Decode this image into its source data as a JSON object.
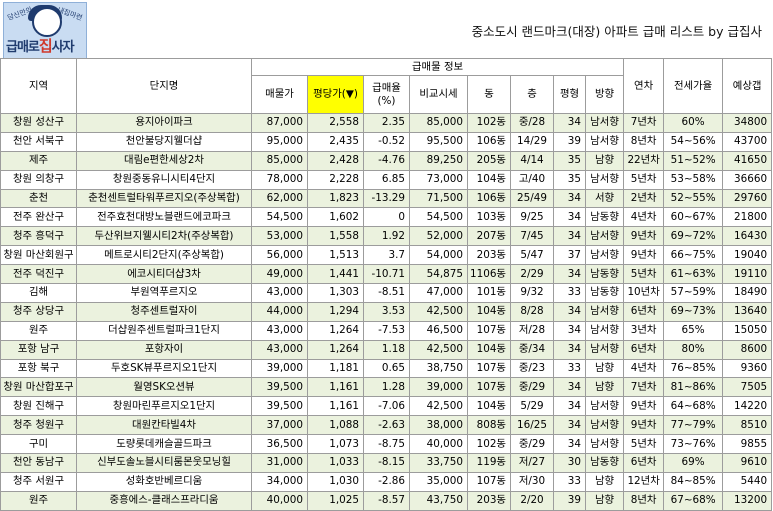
{
  "logo": {
    "top_left": "당신만의",
    "top_right": "내집마련",
    "name_a": "급매로",
    "name_b": "집",
    "name_c": "사자"
  },
  "page_title": "중소도시 랜드마크(대장) 아파트 급매 리스트 by 급집사",
  "header": {
    "group_label": "급매물 정보",
    "region": "지역",
    "complex": "단지명",
    "price": "매물가",
    "ppp": "평당가(▼)",
    "rate": "급매율\n(%)",
    "compare": "비교시세",
    "dong": "동",
    "floor": "층",
    "pyeong": "평형",
    "direction": "방향",
    "age": "연차",
    "jeonse": "전세가율",
    "gap": "예상갭"
  },
  "rows": [
    {
      "region": "창원 성산구",
      "complex": "용지아이파크",
      "price": "87,000",
      "ppp": "2,558",
      "rate": "2.35",
      "compare": "85,000",
      "dong": "102동",
      "floor": "중/28",
      "pyeong": "34",
      "dir": "남서향",
      "age": "7년차",
      "jeonse": "60%",
      "gap": "34800"
    },
    {
      "region": "천안 서북구",
      "complex": "천안불당지웰더샵",
      "price": "95,000",
      "ppp": "2,435",
      "rate": "-0.52",
      "compare": "95,500",
      "dong": "106동",
      "floor": "14/29",
      "pyeong": "39",
      "dir": "남서향",
      "age": "8년차",
      "jeonse": "54~56%",
      "gap": "43700"
    },
    {
      "region": "제주",
      "complex": "대림e편한세상2차",
      "price": "85,000",
      "ppp": "2,428",
      "rate": "-4.76",
      "compare": "89,250",
      "dong": "205동",
      "floor": "4/14",
      "pyeong": "35",
      "dir": "남향",
      "age": "22년차",
      "jeonse": "51~52%",
      "gap": "41650"
    },
    {
      "region": "창원 의창구",
      "complex": "창원중동유니시티4단지",
      "price": "78,000",
      "ppp": "2,228",
      "rate": "6.85",
      "compare": "73,000",
      "dong": "104동",
      "floor": "고/40",
      "pyeong": "35",
      "dir": "남서향",
      "age": "5년차",
      "jeonse": "53~58%",
      "gap": "36660"
    },
    {
      "region": "춘천",
      "complex": "춘천센트럴타워푸르지오(주상복합)",
      "price": "62,000",
      "ppp": "1,823",
      "rate": "-13.29",
      "compare": "71,500",
      "dong": "106동",
      "floor": "25/49",
      "pyeong": "34",
      "dir": "서향",
      "age": "2년차",
      "jeonse": "52~55%",
      "gap": "29760"
    },
    {
      "region": "전주 완산구",
      "complex": "전주효천대방노블랜드에코파크",
      "price": "54,500",
      "ppp": "1,602",
      "rate": "0",
      "compare": "54,500",
      "dong": "103동",
      "floor": "9/25",
      "pyeong": "34",
      "dir": "남동향",
      "age": "4년차",
      "jeonse": "60~67%",
      "gap": "21800"
    },
    {
      "region": "청주 흥덕구",
      "complex": "두산위브지웰시티2차(주상복합)",
      "price": "53,000",
      "ppp": "1,558",
      "rate": "1.92",
      "compare": "52,000",
      "dong": "207동",
      "floor": "7/45",
      "pyeong": "34",
      "dir": "남서향",
      "age": "9년차",
      "jeonse": "69~72%",
      "gap": "16430"
    },
    {
      "region": "창원 마산회원구",
      "complex": "메트로시티2단지(주상복합)",
      "price": "56,000",
      "ppp": "1,513",
      "rate": "3.7",
      "compare": "54,000",
      "dong": "203동",
      "floor": "5/47",
      "pyeong": "37",
      "dir": "남서향",
      "age": "9년차",
      "jeonse": "66~75%",
      "gap": "19040"
    },
    {
      "region": "전주 덕진구",
      "complex": "에코시티더샵3차",
      "price": "49,000",
      "ppp": "1,441",
      "rate": "-10.71",
      "compare": "54,875",
      "dong": "1106동",
      "floor": "2/29",
      "pyeong": "34",
      "dir": "남동향",
      "age": "5년차",
      "jeonse": "61~63%",
      "gap": "19110"
    },
    {
      "region": "김해",
      "complex": "부원역푸르지오",
      "price": "43,000",
      "ppp": "1,303",
      "rate": "-8.51",
      "compare": "47,000",
      "dong": "101동",
      "floor": "9/32",
      "pyeong": "33",
      "dir": "남동향",
      "age": "10년차",
      "jeonse": "57~59%",
      "gap": "18490"
    },
    {
      "region": "청주 상당구",
      "complex": "청주센트럴자이",
      "price": "44,000",
      "ppp": "1,294",
      "rate": "3.53",
      "compare": "42,500",
      "dong": "104동",
      "floor": "8/28",
      "pyeong": "34",
      "dir": "남서향",
      "age": "6년차",
      "jeonse": "69~73%",
      "gap": "13640"
    },
    {
      "region": "원주",
      "complex": "더샵원주센트럴파크1단지",
      "price": "43,000",
      "ppp": "1,264",
      "rate": "-7.53",
      "compare": "46,500",
      "dong": "107동",
      "floor": "저/28",
      "pyeong": "34",
      "dir": "남서향",
      "age": "3년차",
      "jeonse": "65%",
      "gap": "15050"
    },
    {
      "region": "포항 남구",
      "complex": "포항자이",
      "price": "43,000",
      "ppp": "1,264",
      "rate": "1.18",
      "compare": "42,500",
      "dong": "104동",
      "floor": "중/34",
      "pyeong": "34",
      "dir": "남서향",
      "age": "6년차",
      "jeonse": "80%",
      "gap": "8600"
    },
    {
      "region": "포항 북구",
      "complex": "두호SK뷰푸르지오1단지",
      "price": "39,000",
      "ppp": "1,181",
      "rate": "0.65",
      "compare": "38,750",
      "dong": "107동",
      "floor": "중/23",
      "pyeong": "33",
      "dir": "남향",
      "age": "4년차",
      "jeonse": "76~85%",
      "gap": "9360"
    },
    {
      "region": "창원 마산합포구",
      "complex": "월영SK오션뷰",
      "price": "39,500",
      "ppp": "1,161",
      "rate": "1.28",
      "compare": "39,000",
      "dong": "107동",
      "floor": "중/29",
      "pyeong": "34",
      "dir": "남향",
      "age": "7년차",
      "jeonse": "81~86%",
      "gap": "7505"
    },
    {
      "region": "창원 진해구",
      "complex": "창원마린푸르지오1단지",
      "price": "39,500",
      "ppp": "1,161",
      "rate": "-7.06",
      "compare": "42,500",
      "dong": "104동",
      "floor": "5/29",
      "pyeong": "34",
      "dir": "남서향",
      "age": "9년차",
      "jeonse": "64~68%",
      "gap": "14220"
    },
    {
      "region": "청주 청원구",
      "complex": "대원칸타빌4차",
      "price": "37,000",
      "ppp": "1,088",
      "rate": "-2.63",
      "compare": "38,000",
      "dong": "808동",
      "floor": "16/25",
      "pyeong": "34",
      "dir": "남서향",
      "age": "9년차",
      "jeonse": "77~79%",
      "gap": "8510"
    },
    {
      "region": "구미",
      "complex": "도량롯데캐슬골드파크",
      "price": "36,500",
      "ppp": "1,073",
      "rate": "-8.75",
      "compare": "40,000",
      "dong": "102동",
      "floor": "중/29",
      "pyeong": "34",
      "dir": "남서향",
      "age": "5년차",
      "jeonse": "73~76%",
      "gap": "9855"
    },
    {
      "region": "천안 동남구",
      "complex": "신부도솔노블시티룸몬웃모닝힐",
      "price": "31,000",
      "ppp": "1,033",
      "rate": "-8.15",
      "compare": "33,750",
      "dong": "119동",
      "floor": "저/27",
      "pyeong": "30",
      "dir": "남동향",
      "age": "6년차",
      "jeonse": "69%",
      "gap": "9610"
    },
    {
      "region": "청주 서원구",
      "complex": "성화호반베르디움",
      "price": "34,000",
      "ppp": "1,030",
      "rate": "-2.86",
      "compare": "35,000",
      "dong": "107동",
      "floor": "저/30",
      "pyeong": "33",
      "dir": "남향",
      "age": "12년차",
      "jeonse": "84~85%",
      "gap": "5440"
    },
    {
      "region": "원주",
      "complex": "중흥에스-클래스프라디움",
      "price": "40,000",
      "ppp": "1,025",
      "rate": "-8.57",
      "compare": "43,750",
      "dong": "203동",
      "floor": "2/20",
      "pyeong": "39",
      "dir": "남향",
      "age": "8년차",
      "jeonse": "67~68%",
      "gap": "13200"
    }
  ]
}
